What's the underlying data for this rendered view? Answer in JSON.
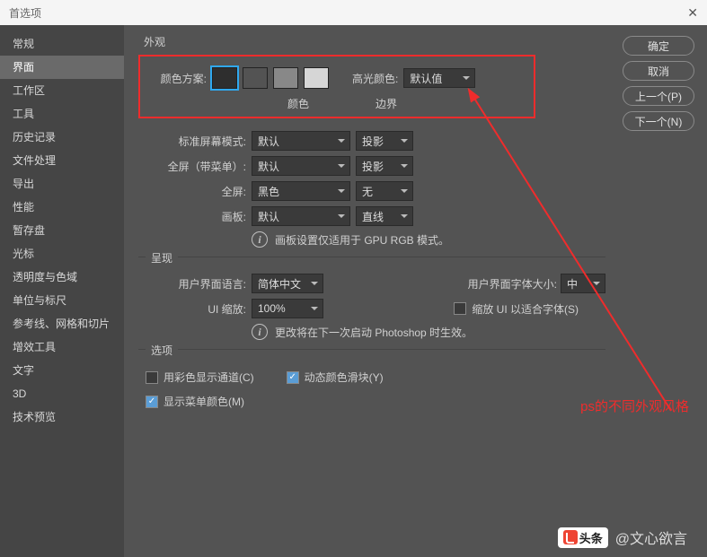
{
  "window": {
    "title": "首选项"
  },
  "sidebar": {
    "items": [
      "常规",
      "界面",
      "工作区",
      "工具",
      "历史记录",
      "文件处理",
      "导出",
      "性能",
      "暂存盘",
      "光标",
      "透明度与色域",
      "单位与标尺",
      "参考线、网格和切片",
      "增效工具",
      "文字",
      "3D",
      "技术预览"
    ],
    "selected_index": 1
  },
  "buttons": {
    "ok": "确定",
    "cancel": "取消",
    "prev": "上一个(P)",
    "next": "下一个(N)"
  },
  "appearance": {
    "group": "外观",
    "scheme_label": "颜色方案:",
    "scheme_colors": [
      "#2e2e2e",
      "#535353",
      "#888888",
      "#d6d6d6"
    ],
    "highlight_label": "高光颜色:",
    "highlight_value": "默认值",
    "sub_color": "颜色",
    "sub_border": "边界"
  },
  "screen": {
    "std_label": "标准屏幕模式:",
    "full_menu_label": "全屏（带菜单）:",
    "full_label": "全屏:",
    "artboard_label": "画板:",
    "default": "默认",
    "shadow": "投影",
    "black": "黑色",
    "none": "无",
    "line": "直线",
    "info": "画板设置仅适用于 GPU RGB 模式。"
  },
  "present": {
    "group": "呈现",
    "lang_label": "用户界面语言:",
    "lang_value": "简体中文",
    "font_label": "用户界面字体大小:",
    "font_value": "中",
    "scale_label": "UI 缩放:",
    "scale_value": "100%",
    "scale_check": "缩放 UI 以适合字体(S)",
    "info": "更改将在下一次启动 Photoshop 时生效。"
  },
  "options": {
    "group": "选项",
    "colored_channels": "用彩色显示通道(C)",
    "dynamic_sliders": "动态颜色滑块(Y)",
    "show_menu_colors": "显示菜单颜色(M)"
  },
  "annotation": "ps的不同外观风格",
  "watermark": {
    "brand": "头条",
    "author": "@文心欲言"
  }
}
